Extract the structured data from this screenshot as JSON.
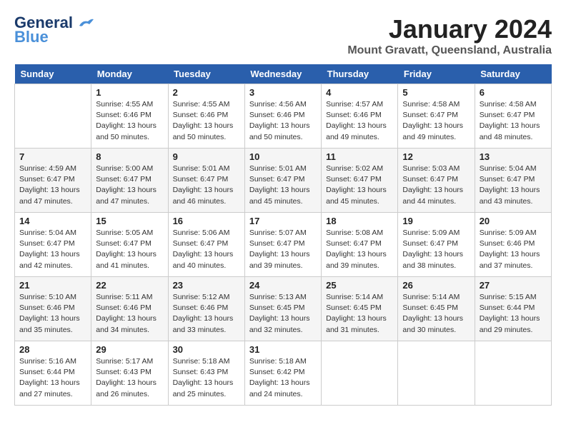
{
  "logo": {
    "general": "General",
    "blue": "Blue"
  },
  "title": {
    "month_year": "January 2024",
    "location": "Mount Gravatt, Queensland, Australia"
  },
  "columns": [
    "Sunday",
    "Monday",
    "Tuesday",
    "Wednesday",
    "Thursday",
    "Friday",
    "Saturday"
  ],
  "weeks": [
    [
      {
        "day": "",
        "info": ""
      },
      {
        "day": "1",
        "info": "Sunrise: 4:55 AM\nSunset: 6:46 PM\nDaylight: 13 hours\nand 50 minutes."
      },
      {
        "day": "2",
        "info": "Sunrise: 4:55 AM\nSunset: 6:46 PM\nDaylight: 13 hours\nand 50 minutes."
      },
      {
        "day": "3",
        "info": "Sunrise: 4:56 AM\nSunset: 6:46 PM\nDaylight: 13 hours\nand 50 minutes."
      },
      {
        "day": "4",
        "info": "Sunrise: 4:57 AM\nSunset: 6:46 PM\nDaylight: 13 hours\nand 49 minutes."
      },
      {
        "day": "5",
        "info": "Sunrise: 4:58 AM\nSunset: 6:47 PM\nDaylight: 13 hours\nand 49 minutes."
      },
      {
        "day": "6",
        "info": "Sunrise: 4:58 AM\nSunset: 6:47 PM\nDaylight: 13 hours\nand 48 minutes."
      }
    ],
    [
      {
        "day": "7",
        "info": "Sunrise: 4:59 AM\nSunset: 6:47 PM\nDaylight: 13 hours\nand 47 minutes."
      },
      {
        "day": "8",
        "info": "Sunrise: 5:00 AM\nSunset: 6:47 PM\nDaylight: 13 hours\nand 47 minutes."
      },
      {
        "day": "9",
        "info": "Sunrise: 5:01 AM\nSunset: 6:47 PM\nDaylight: 13 hours\nand 46 minutes."
      },
      {
        "day": "10",
        "info": "Sunrise: 5:01 AM\nSunset: 6:47 PM\nDaylight: 13 hours\nand 45 minutes."
      },
      {
        "day": "11",
        "info": "Sunrise: 5:02 AM\nSunset: 6:47 PM\nDaylight: 13 hours\nand 45 minutes."
      },
      {
        "day": "12",
        "info": "Sunrise: 5:03 AM\nSunset: 6:47 PM\nDaylight: 13 hours\nand 44 minutes."
      },
      {
        "day": "13",
        "info": "Sunrise: 5:04 AM\nSunset: 6:47 PM\nDaylight: 13 hours\nand 43 minutes."
      }
    ],
    [
      {
        "day": "14",
        "info": "Sunrise: 5:04 AM\nSunset: 6:47 PM\nDaylight: 13 hours\nand 42 minutes."
      },
      {
        "day": "15",
        "info": "Sunrise: 5:05 AM\nSunset: 6:47 PM\nDaylight: 13 hours\nand 41 minutes."
      },
      {
        "day": "16",
        "info": "Sunrise: 5:06 AM\nSunset: 6:47 PM\nDaylight: 13 hours\nand 40 minutes."
      },
      {
        "day": "17",
        "info": "Sunrise: 5:07 AM\nSunset: 6:47 PM\nDaylight: 13 hours\nand 39 minutes."
      },
      {
        "day": "18",
        "info": "Sunrise: 5:08 AM\nSunset: 6:47 PM\nDaylight: 13 hours\nand 39 minutes."
      },
      {
        "day": "19",
        "info": "Sunrise: 5:09 AM\nSunset: 6:47 PM\nDaylight: 13 hours\nand 38 minutes."
      },
      {
        "day": "20",
        "info": "Sunrise: 5:09 AM\nSunset: 6:46 PM\nDaylight: 13 hours\nand 37 minutes."
      }
    ],
    [
      {
        "day": "21",
        "info": "Sunrise: 5:10 AM\nSunset: 6:46 PM\nDaylight: 13 hours\nand 35 minutes."
      },
      {
        "day": "22",
        "info": "Sunrise: 5:11 AM\nSunset: 6:46 PM\nDaylight: 13 hours\nand 34 minutes."
      },
      {
        "day": "23",
        "info": "Sunrise: 5:12 AM\nSunset: 6:46 PM\nDaylight: 13 hours\nand 33 minutes."
      },
      {
        "day": "24",
        "info": "Sunrise: 5:13 AM\nSunset: 6:45 PM\nDaylight: 13 hours\nand 32 minutes."
      },
      {
        "day": "25",
        "info": "Sunrise: 5:14 AM\nSunset: 6:45 PM\nDaylight: 13 hours\nand 31 minutes."
      },
      {
        "day": "26",
        "info": "Sunrise: 5:14 AM\nSunset: 6:45 PM\nDaylight: 13 hours\nand 30 minutes."
      },
      {
        "day": "27",
        "info": "Sunrise: 5:15 AM\nSunset: 6:44 PM\nDaylight: 13 hours\nand 29 minutes."
      }
    ],
    [
      {
        "day": "28",
        "info": "Sunrise: 5:16 AM\nSunset: 6:44 PM\nDaylight: 13 hours\nand 27 minutes."
      },
      {
        "day": "29",
        "info": "Sunrise: 5:17 AM\nSunset: 6:43 PM\nDaylight: 13 hours\nand 26 minutes."
      },
      {
        "day": "30",
        "info": "Sunrise: 5:18 AM\nSunset: 6:43 PM\nDaylight: 13 hours\nand 25 minutes."
      },
      {
        "day": "31",
        "info": "Sunrise: 5:18 AM\nSunset: 6:42 PM\nDaylight: 13 hours\nand 24 minutes."
      },
      {
        "day": "",
        "info": ""
      },
      {
        "day": "",
        "info": ""
      },
      {
        "day": "",
        "info": ""
      }
    ]
  ]
}
